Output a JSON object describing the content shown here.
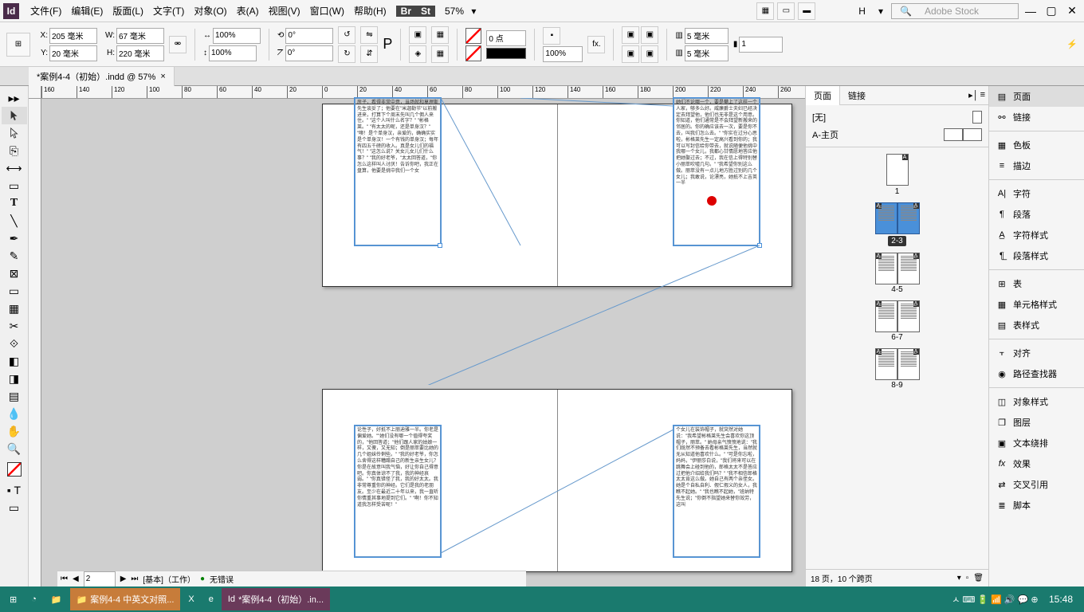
{
  "app_logo": "Id",
  "menu": {
    "file": "文件(F)",
    "edit": "编辑(E)",
    "layout": "版面(L)",
    "type": "文字(T)",
    "object": "对象(O)",
    "table": "表(A)",
    "view": "视图(V)",
    "window": "窗口(W)",
    "help": "帮助(H)"
  },
  "top": {
    "badge_br": "Br",
    "badge_st": "St",
    "zoom": "57%",
    "letter_h": "H",
    "search_placeholder": "Adobe Stock"
  },
  "control": {
    "x": "205 毫米",
    "y": "20 毫米",
    "w": "67 毫米",
    "h": "220 毫米",
    "scale_x": "100%",
    "scale_y": "100%",
    "rotate": "0°",
    "shear": "0°",
    "stroke_pt": "0 点",
    "effect_pct": "100%",
    "col_val": "5 毫米",
    "col_cnt": "1",
    "col_gap": "5 毫米"
  },
  "doc_tab": "*案例4-4（初始）.indd @ 57%",
  "ruler_marks": [
    "160",
    "140",
    "120",
    "100",
    "80",
    "60",
    "40",
    "20",
    "0",
    "20",
    "40",
    "60",
    "80",
    "100",
    "120",
    "140",
    "160",
    "180",
    "200",
    "220",
    "240",
    "260"
  ],
  "pages_panel": {
    "tab_pages": "页面",
    "tab_links": "链接",
    "master_none": "[无]",
    "master_a": "A-主页",
    "labels": [
      "1",
      "2-3",
      "4-5",
      "6-7",
      "8-9"
    ],
    "footer": "18 页，10 个跨页"
  },
  "right_rail": {
    "pages": "页面",
    "links": "链接",
    "swatches": "色板",
    "stroke": "描边",
    "character": "字符",
    "paragraph": "段落",
    "char_styles": "字符样式",
    "para_styles": "段落样式",
    "table": "表",
    "cell_styles": "单元格样式",
    "table_styles": "表样式",
    "align": "对齐",
    "pathfinder": "路径查找器",
    "obj_styles": "对象样式",
    "layers": "图层",
    "text_wrap": "文本绕排",
    "effects": "效果",
    "xref": "交叉引用",
    "scripts": "脚本"
  },
  "status": {
    "page_no": "2",
    "preset": "[基本]（工作）",
    "no_errors": "无错误"
  },
  "taskbar": {
    "item1": "案例4-4 中英文对照...",
    "item2": "*案例4-4（初始）.in...",
    "clock": "15:48"
  },
  "frame_text": {
    "f1": "房子，看得非常中意，当场就和莫理斯先生谈妥了；他要在\"米迦勒节\"以前搬进来，打算下个周末先叫几个佣人来住。\"\n\"这个人叫什么名字？\"\n\"彬格莱。\"\n\"有太太的呢，还是单身汉？\"\n\"噢！是个单身汉，亲爱的，确确实实是个单身汉！一个有钱的单身汉；每年有四五千磅的收入。真是女儿们的福气！\"\n\"这怎么说？关女儿女儿们什么事？\"\n\"我的好老爷，\"太太回答道，\"你怎么这样叫人讨厌！告诉你吧，我正在盘算，他要是挑中我们一个女",
    "f2": "她们不论哪一个，要是攀上了这样一个人家，够多么好。威廉爵士夫妇已经决定去拜望他，他们也无非是这个用意。你知道，他们通常是不会拜望新搬来的邻居的。你的确应该去一次，要是你不去，叫我们怎么去。\"\n\"你实在过分心思啦，彬格莱先生一定高兴看到你的；我可以写封信给你带去，就说随便他挑中我哪一个女儿，我都心甘情愿地答应他把她娶过去；不过，我在信上得特别替小丽萃吹嘘几句。\"\n\"我希望你别这么做。丽萃没有一点儿地方胜过别的几个女儿；我敢说，论漂亮，她抵不上吉英一半",
    "f3": "论性子，好抵不上丽迪雅一半。你老是偏爱她。\"\"她们没有哪一个值得夸奖的，\"他回答道；\"他们跟人家的姑娘一样，又傻，又无知；倒是丽萃要比她的几个姐妹伶俐些。\"\n\"我的好老爷，你怎么舍得这样糟蹋自己的新生亲生女儿？你是在故意叫我气恼，好让你自己得意吧。你真体谅不了我，我的神经哀弱。\"\n\"你真错怪了我，我的好太太。我非常尊重你的神经。它们是我的老朋友。至少在最近二十年以来，我一直听你情重其事地提到它们。\"\n\"啊！你不知道我怎样受苦呢！\"",
    "f4": "个女儿在装饰帽子，就突然对她说：\"我希望彬格莱先生会喜欢你这顶帽子，丽萃。\"\n她母亲气愤愤地说：\"我们既然不预备去看彬格莱先生，当然就无从知道他喜欢什么。\"\n\"可是你忘啦，妈妈，\"伊丽莎白说，\"我们将来可以在跳舞会上碰到他的，郎格太太不是答应过把他介绍给我们吗？\"\n\"我不相信郎格太太肯这么做。她自己有两个亲侄女。她是个自私自利、假仁假义的女人，我瞧不起她。\"\n\"我也瞧不起她，\"班纳特先生说；\"你倒不指望她来替你效劳，这叫"
  }
}
